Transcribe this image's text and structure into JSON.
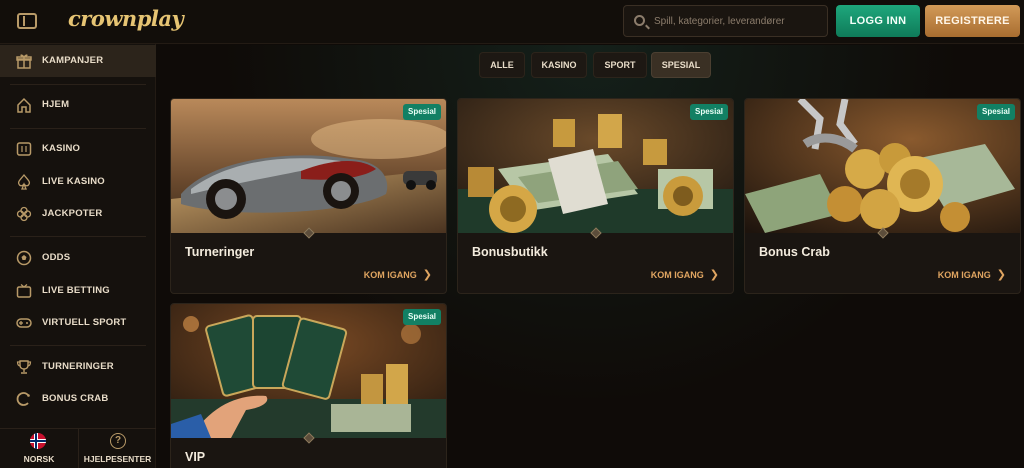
{
  "header": {
    "logo": "crownplay",
    "search_placeholder": "Spill, kategorier, leverandører",
    "login_label": "LOGG INN",
    "register_label": "REGISTRERE"
  },
  "sidebar": {
    "items": [
      {
        "label": "KAMPANJER",
        "icon": "gift-icon"
      },
      {
        "label": "HJEM",
        "icon": "home-icon"
      },
      {
        "label": "KASINO",
        "icon": "slot-machine-icon"
      },
      {
        "label": "LIVE KASINO",
        "icon": "spade-icon"
      },
      {
        "label": "JACKPOTER",
        "icon": "clover-icon"
      },
      {
        "label": "ODDS",
        "icon": "ball-icon"
      },
      {
        "label": "LIVE BETTING",
        "icon": "live-icon"
      },
      {
        "label": "VIRTUELL SPORT",
        "icon": "gamepad-icon"
      },
      {
        "label": "TURNERINGER",
        "icon": "trophy-icon"
      },
      {
        "label": "BONUS CRAB",
        "icon": "bonus-icon"
      }
    ],
    "footer": {
      "language_label": "NORSK",
      "help_label": "HJELPESENTER"
    }
  },
  "filters": [
    "ALLE",
    "KASINO",
    "SPORT",
    "SPESIAL"
  ],
  "active_filter": "SPESIAL",
  "cards": [
    {
      "title": "Turneringer",
      "badge": "Spesial",
      "cta": "KOM IGANG"
    },
    {
      "title": "Bonusbutikk",
      "badge": "Spesial",
      "cta": "KOM IGANG"
    },
    {
      "title": "Bonus Crab",
      "badge": "Spesial",
      "cta": "KOM IGANG"
    },
    {
      "title": "VIP",
      "badge": "Spesial",
      "cta": ""
    }
  ],
  "colors": {
    "accent_green": "#128064",
    "accent_gold": "#e0a561",
    "background": "#0f0b08"
  }
}
